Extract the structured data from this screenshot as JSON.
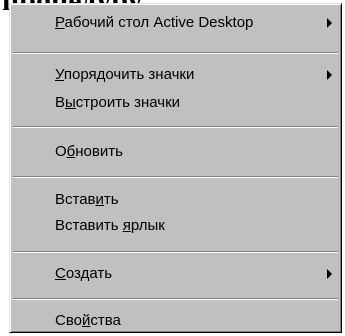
{
  "background": {
    "heading_text": "процедуру"
  },
  "menu": {
    "items": [
      {
        "id": "active-desktop",
        "pre": "",
        "mnemonic": "Р",
        "post": "абочий стол Active Desktop",
        "submenu": true
      },
      {
        "id": "arrange-icons",
        "pre": "",
        "mnemonic": "У",
        "post": "порядочить значки",
        "submenu": true
      },
      {
        "id": "line-up-icons",
        "pre": "В",
        "mnemonic": "ы",
        "post": "строить значки",
        "submenu": false
      },
      {
        "id": "refresh",
        "pre": "О",
        "mnemonic": "б",
        "post": "новить",
        "submenu": false
      },
      {
        "id": "paste",
        "pre": "Встав",
        "mnemonic": "и",
        "post": "ть",
        "submenu": false
      },
      {
        "id": "paste-shortcut",
        "pre": "Вставить ",
        "mnemonic": "я",
        "post": "рлык",
        "submenu": false
      },
      {
        "id": "new",
        "pre": "",
        "mnemonic": "С",
        "post": "оздать",
        "submenu": true
      },
      {
        "id": "properties",
        "pre": "Сво",
        "mnemonic": "й",
        "post": "ства",
        "submenu": false
      }
    ],
    "colors": {
      "face": "#c0c0c0",
      "shadow": "#808080",
      "highlight": "#ffffff",
      "text": "#000000"
    }
  }
}
